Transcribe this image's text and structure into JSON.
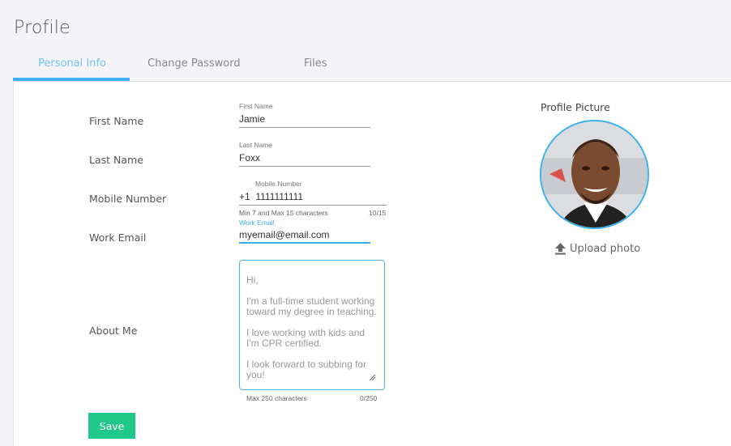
{
  "page": {
    "title": "Profile"
  },
  "tabs": [
    {
      "label": "Personal Info",
      "active": true
    },
    {
      "label": "Change Password",
      "active": false
    },
    {
      "label": "Files",
      "active": false
    }
  ],
  "form": {
    "first_name": {
      "row_label": "First Name",
      "field_label": "First Name",
      "value": "Jamie"
    },
    "last_name": {
      "row_label": "Last Name",
      "field_label": "Last Name",
      "value": "Foxx"
    },
    "mobile": {
      "row_label": "Mobile Number",
      "field_label": "Mobile Number",
      "prefix": "+1",
      "value": "1111111111",
      "hint": "Min 7 and Max 15 characters",
      "counter": "10/15"
    },
    "work_email": {
      "row_label": "Work Email",
      "field_label": "Work Email",
      "value": "myemail@email.com"
    },
    "about_me": {
      "row_label": "About Me",
      "placeholder": "Hi,\n\nI'm a full-time student working toward my degree in teaching.\n\nI love working with kids and I'm CPR certified.\n\nI look forward to subbing for you!",
      "hint": "Max 250 characters",
      "counter": "0/250"
    },
    "save_label": "Save"
  },
  "profile_picture": {
    "label": "Profile Picture",
    "upload_label": "Upload photo",
    "upload_icon": "upload-icon"
  },
  "colors": {
    "accent": "#3bb0ee",
    "save": "#20c98a"
  }
}
